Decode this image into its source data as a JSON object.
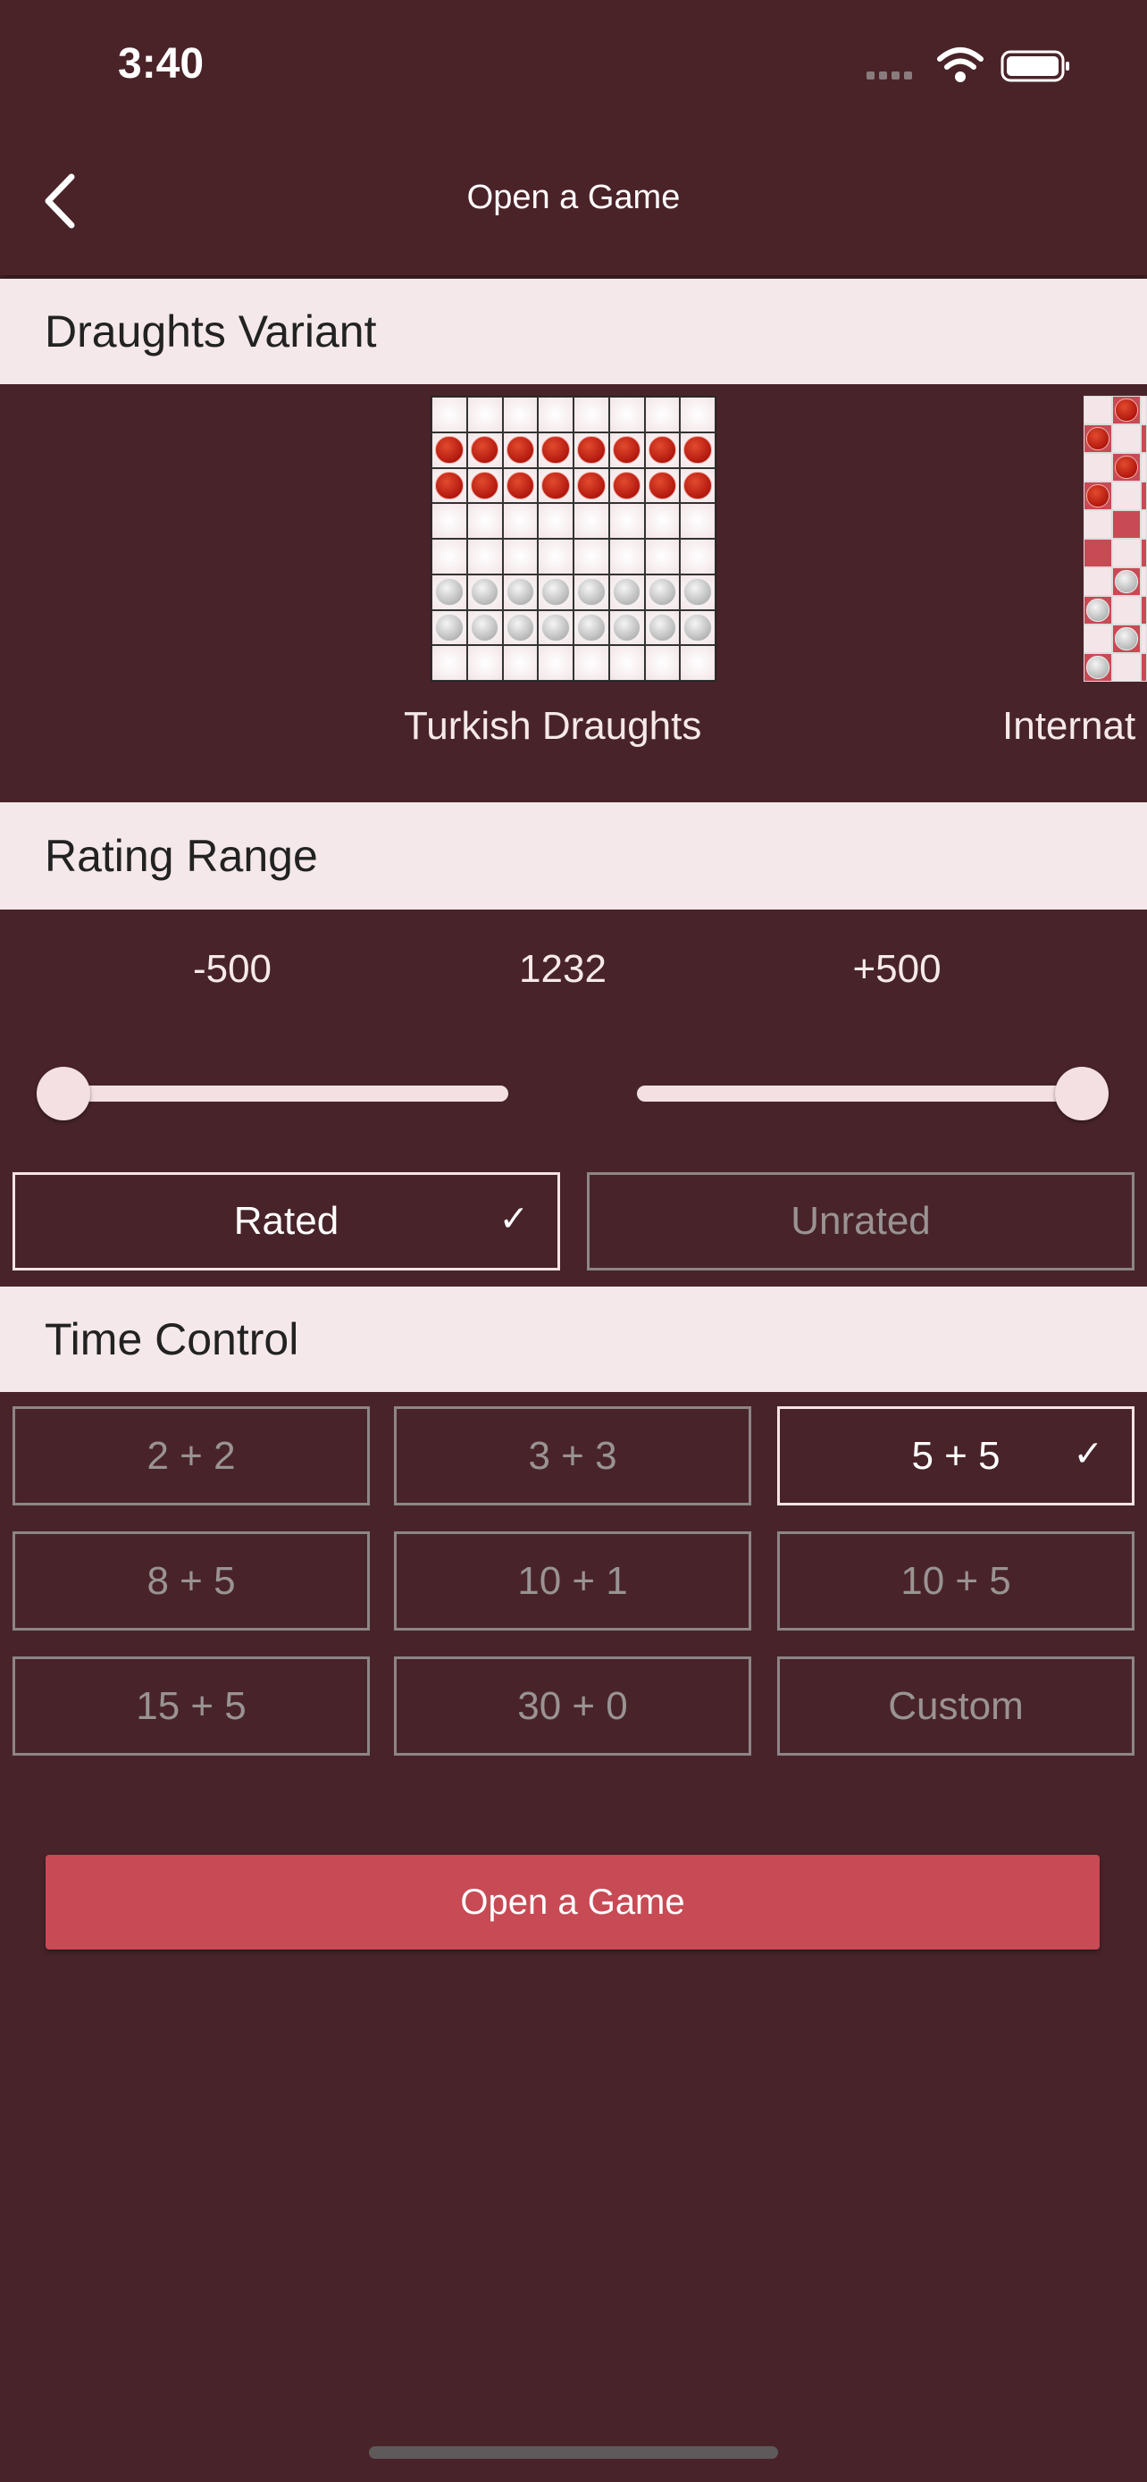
{
  "status_bar": {
    "time": "3:40",
    "icons": [
      "signal-icon",
      "wifi-icon",
      "battery-icon"
    ]
  },
  "nav": {
    "title": "Open a Game",
    "back_icon": "chevron-left-icon"
  },
  "variant_section": {
    "title": "Draughts Variant",
    "variants": [
      {
        "label": "Turkish Draughts",
        "selected": true
      },
      {
        "label": "International Draughts",
        "visible_label": "Internat"
      }
    ]
  },
  "rating_section": {
    "title": "Rating Range",
    "min_label": "-500",
    "current": "1232",
    "max_label": "+500",
    "slider_min_value": -500,
    "slider_max_value": 500,
    "options": [
      {
        "label": "Rated",
        "selected": true
      },
      {
        "label": "Unrated",
        "selected": false
      }
    ]
  },
  "time_section": {
    "title": "Time Control",
    "options": [
      {
        "label": "2 + 2",
        "selected": false
      },
      {
        "label": "3 + 3",
        "selected": false
      },
      {
        "label": "5 + 5",
        "selected": true
      },
      {
        "label": "8 + 5",
        "selected": false
      },
      {
        "label": "10 + 1",
        "selected": false
      },
      {
        "label": "10 + 5",
        "selected": false
      },
      {
        "label": "15 + 5",
        "selected": false
      },
      {
        "label": "30 + 0",
        "selected": false
      },
      {
        "label": "Custom",
        "selected": false
      }
    ]
  },
  "cta": {
    "label": "Open a Game"
  },
  "colors": {
    "background": "#48242a",
    "section": "#f4e8ea",
    "accent": "#c84a55"
  }
}
